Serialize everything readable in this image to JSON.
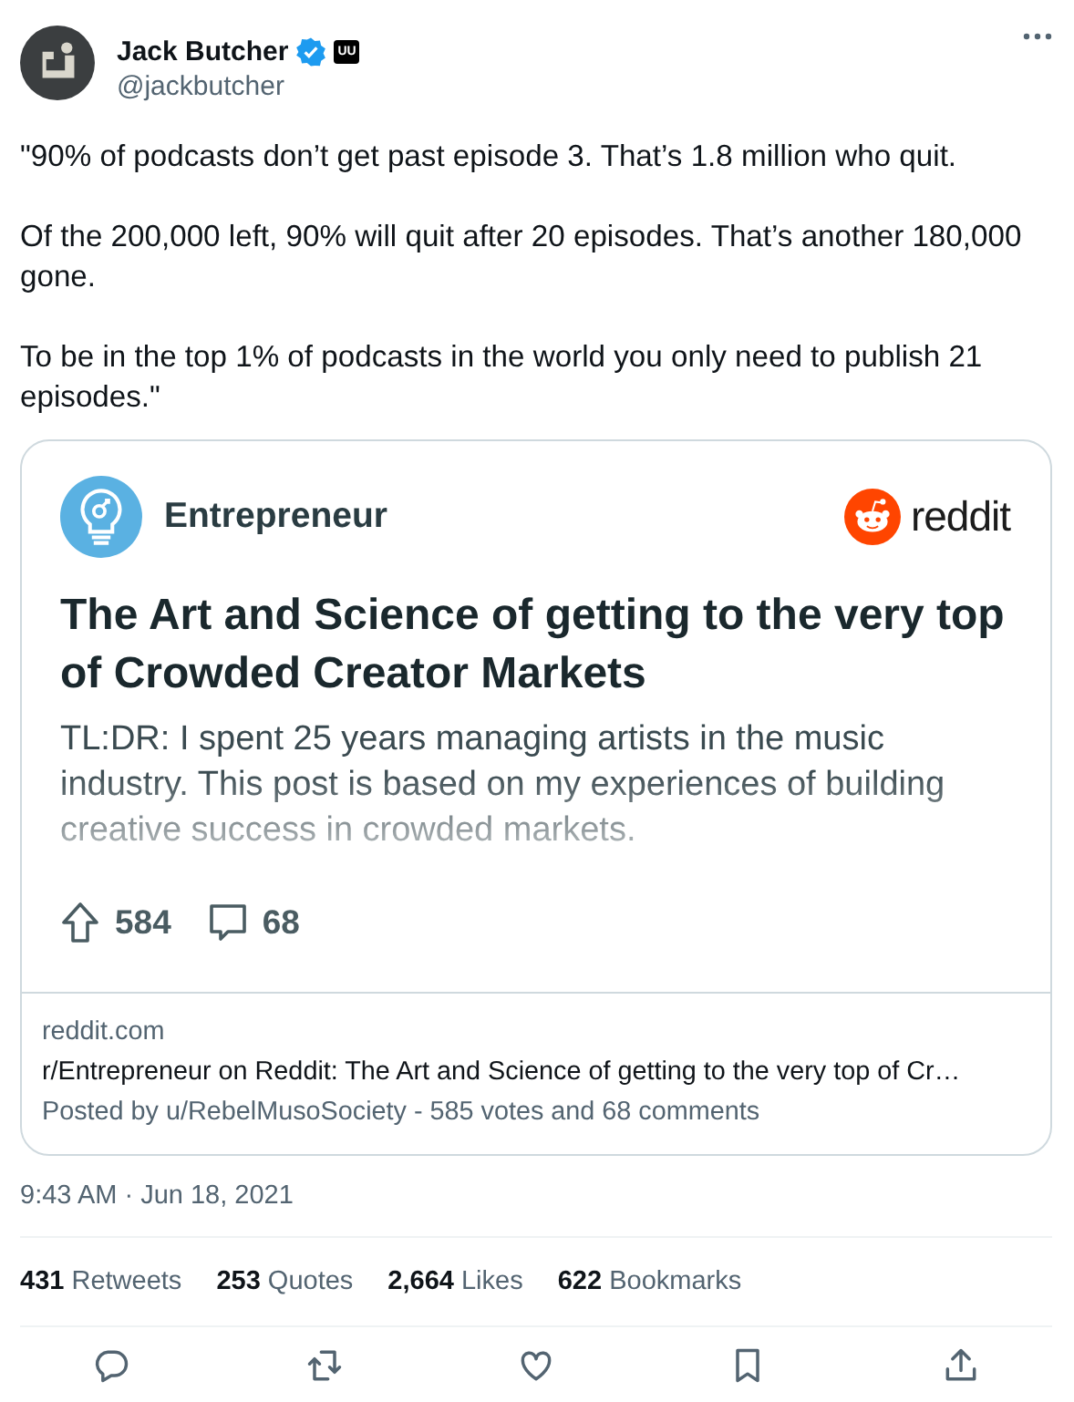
{
  "author": {
    "name": "Jack Butcher",
    "verified": true,
    "affiliate_badge": "UU",
    "handle": "@jackbutcher"
  },
  "text": [
    "\"90% of podcasts don’t get past episode 3. That’s 1.8 million who quit.",
    "Of the 200,000 left, 90% will quit after 20 episodes. That’s another 180,000 gone.",
    "To be in the top 1% of podcasts in the world you only need to publish 21 episodes.\""
  ],
  "link_card": {
    "community": "Entrepreneur",
    "brand": "reddit",
    "title": "The Art and Science of getting to the very top of Crowded Creator Markets",
    "summary": "TL:DR: I spent 25 years managing artists in the music industry. This post is based on my experiences of building creative success in crowded markets.",
    "upvotes": "584",
    "comments": "68",
    "domain": "reddit.com",
    "link_title": "r/Entrepreneur on Reddit: The Art and Science of getting to the very top of Cr…",
    "byline": "Posted by u/RebelMusoSociety - 585 votes and 68 comments"
  },
  "timestamp": "9:43 AM · Jun 18, 2021",
  "stats": [
    {
      "count": "431",
      "label": "Retweets"
    },
    {
      "count": "253",
      "label": "Quotes"
    },
    {
      "count": "2,664",
      "label": "Likes"
    },
    {
      "count": "622",
      "label": "Bookmarks"
    }
  ],
  "actions": [
    {
      "kind": "reply"
    },
    {
      "kind": "retweet"
    },
    {
      "kind": "like"
    },
    {
      "kind": "bookmark"
    },
    {
      "kind": "share"
    }
  ]
}
